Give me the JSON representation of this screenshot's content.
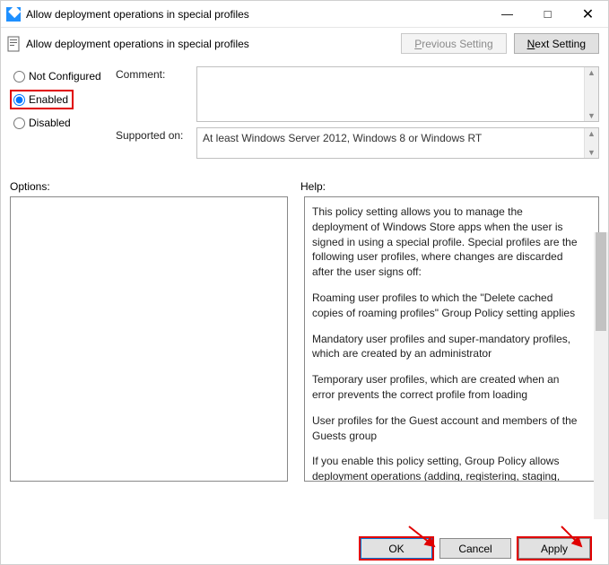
{
  "window": {
    "title": "Allow deployment operations in special profiles"
  },
  "header": {
    "subtitle": "Allow deployment operations in special profiles",
    "prev_html": "<span class='ul'>P</span>revious Setting",
    "next_html": "<span class='ul'>N</span>ext Setting"
  },
  "radios": {
    "not_configured": "Not Configured",
    "enabled": "Enabled",
    "disabled": "Disabled",
    "selected": "enabled"
  },
  "fields": {
    "comment_label": "Comment:",
    "comment_value": "",
    "supported_label": "Supported on:",
    "supported_value": "At least Windows Server 2012, Windows 8 or Windows RT"
  },
  "labels": {
    "options": "Options:",
    "help": "Help:"
  },
  "help": {
    "p1": "This policy setting allows you to manage the deployment of Windows Store apps when the user is signed in using a special profile. Special profiles are the following user profiles, where changes are discarded after the user signs off:",
    "p2": "Roaming user profiles to which the \"Delete cached copies of roaming profiles\" Group Policy setting applies",
    "p3": "Mandatory user profiles and super-mandatory profiles, which are created by an administrator",
    "p4": "Temporary user profiles, which are created when an error prevents the correct profile from loading",
    "p5": "User profiles for the Guest account and members of the Guests group",
    "p6": "If you enable this policy setting, Group Policy allows deployment operations (adding, registering, staging, updating, or removing an app package) of Windows Store apps when using a special"
  },
  "buttons": {
    "ok": "OK",
    "cancel": "Cancel",
    "apply": "Apply"
  }
}
